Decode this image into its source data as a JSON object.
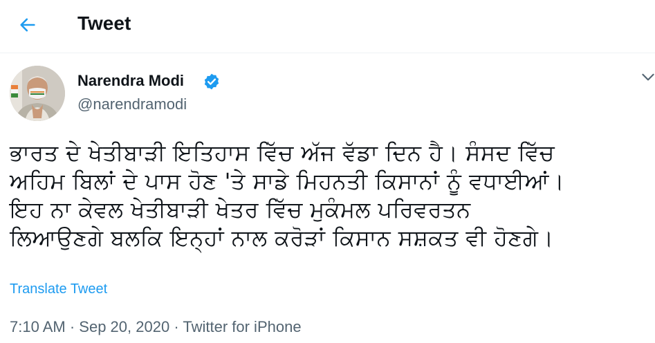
{
  "header": {
    "back_icon": "arrow-left-icon",
    "title": "Tweet"
  },
  "author": {
    "name": "Narendra Modi",
    "handle": "@narendramodi",
    "verified_icon": "verified-badge-icon",
    "menu_icon": "chevron-down-icon"
  },
  "tweet": {
    "lines": [
      "ਭਾਰਤ ਦੇ ਖੇਤੀਬਾੜੀ ਇਤਿਹਾਸ ਵਿੱਚ ਅੱਜ ਵੱਡਾ ਦਿਨ ਹੈ। ਸੰਸਦ ਵਿੱਚ",
      "ਅਹਿਮ ਬਿਲਾਂ ਦੇ ਪਾਸ ਹੋਣ 'ਤੇ ਸਾਡੇ ਮਿਹਨਤੀ ਕਿਸਾਨਾਂ ਨੂੰ ਵਧਾਈਆਂ।",
      "ਇਹ ਨਾ ਕੇਵਲ ਖੇਤੀਬਾੜੀ ਖੇਤਰ ਵਿੱਚ ਮੁਕੰਮਲ ਪਰਿਵਰਤਨ",
      "ਲਿਆਉਣਗੇ ਬਲਕਿ ਇਨ੍ਹਾਂ ਨਾਲ ਕਰੋੜਾਂ ਕਿਸਾਨ ਸਸ਼ਕਤ ਵੀ ਹੋਣਗੇ।"
    ],
    "translate_label": "Translate Tweet",
    "time": "7:10 AM",
    "separator": "·",
    "date": "Sep 20, 2020",
    "source": "Twitter for iPhone"
  },
  "colors": {
    "accent": "#1d9bf0",
    "text": "#0f1419",
    "secondary": "#536471",
    "divider": "#eff3f4"
  }
}
